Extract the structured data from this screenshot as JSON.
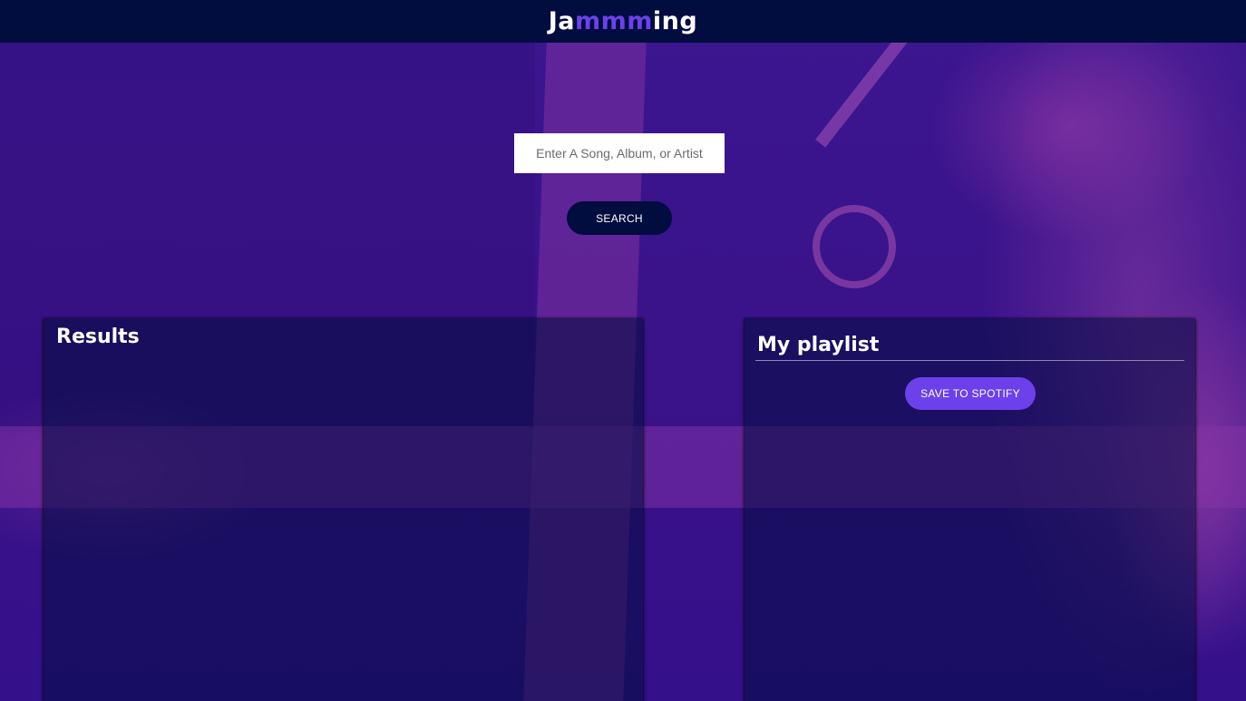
{
  "header": {
    "logo_prefix": "Ja",
    "logo_accent": "mmm",
    "logo_suffix": "ing"
  },
  "search": {
    "placeholder": "Enter A Song, Album, or Artist",
    "value": "",
    "button_label": "SEARCH"
  },
  "results": {
    "title": "Results",
    "tracks": []
  },
  "playlist": {
    "name": "My playlist",
    "save_label": "SAVE TO SPOTIFY",
    "tracks": []
  },
  "colors": {
    "header_bg": "#010c3f",
    "accent": "#6c41ec",
    "background": "#3b1690",
    "panel_bg": "rgba(1, 12, 63, 0.55)"
  }
}
